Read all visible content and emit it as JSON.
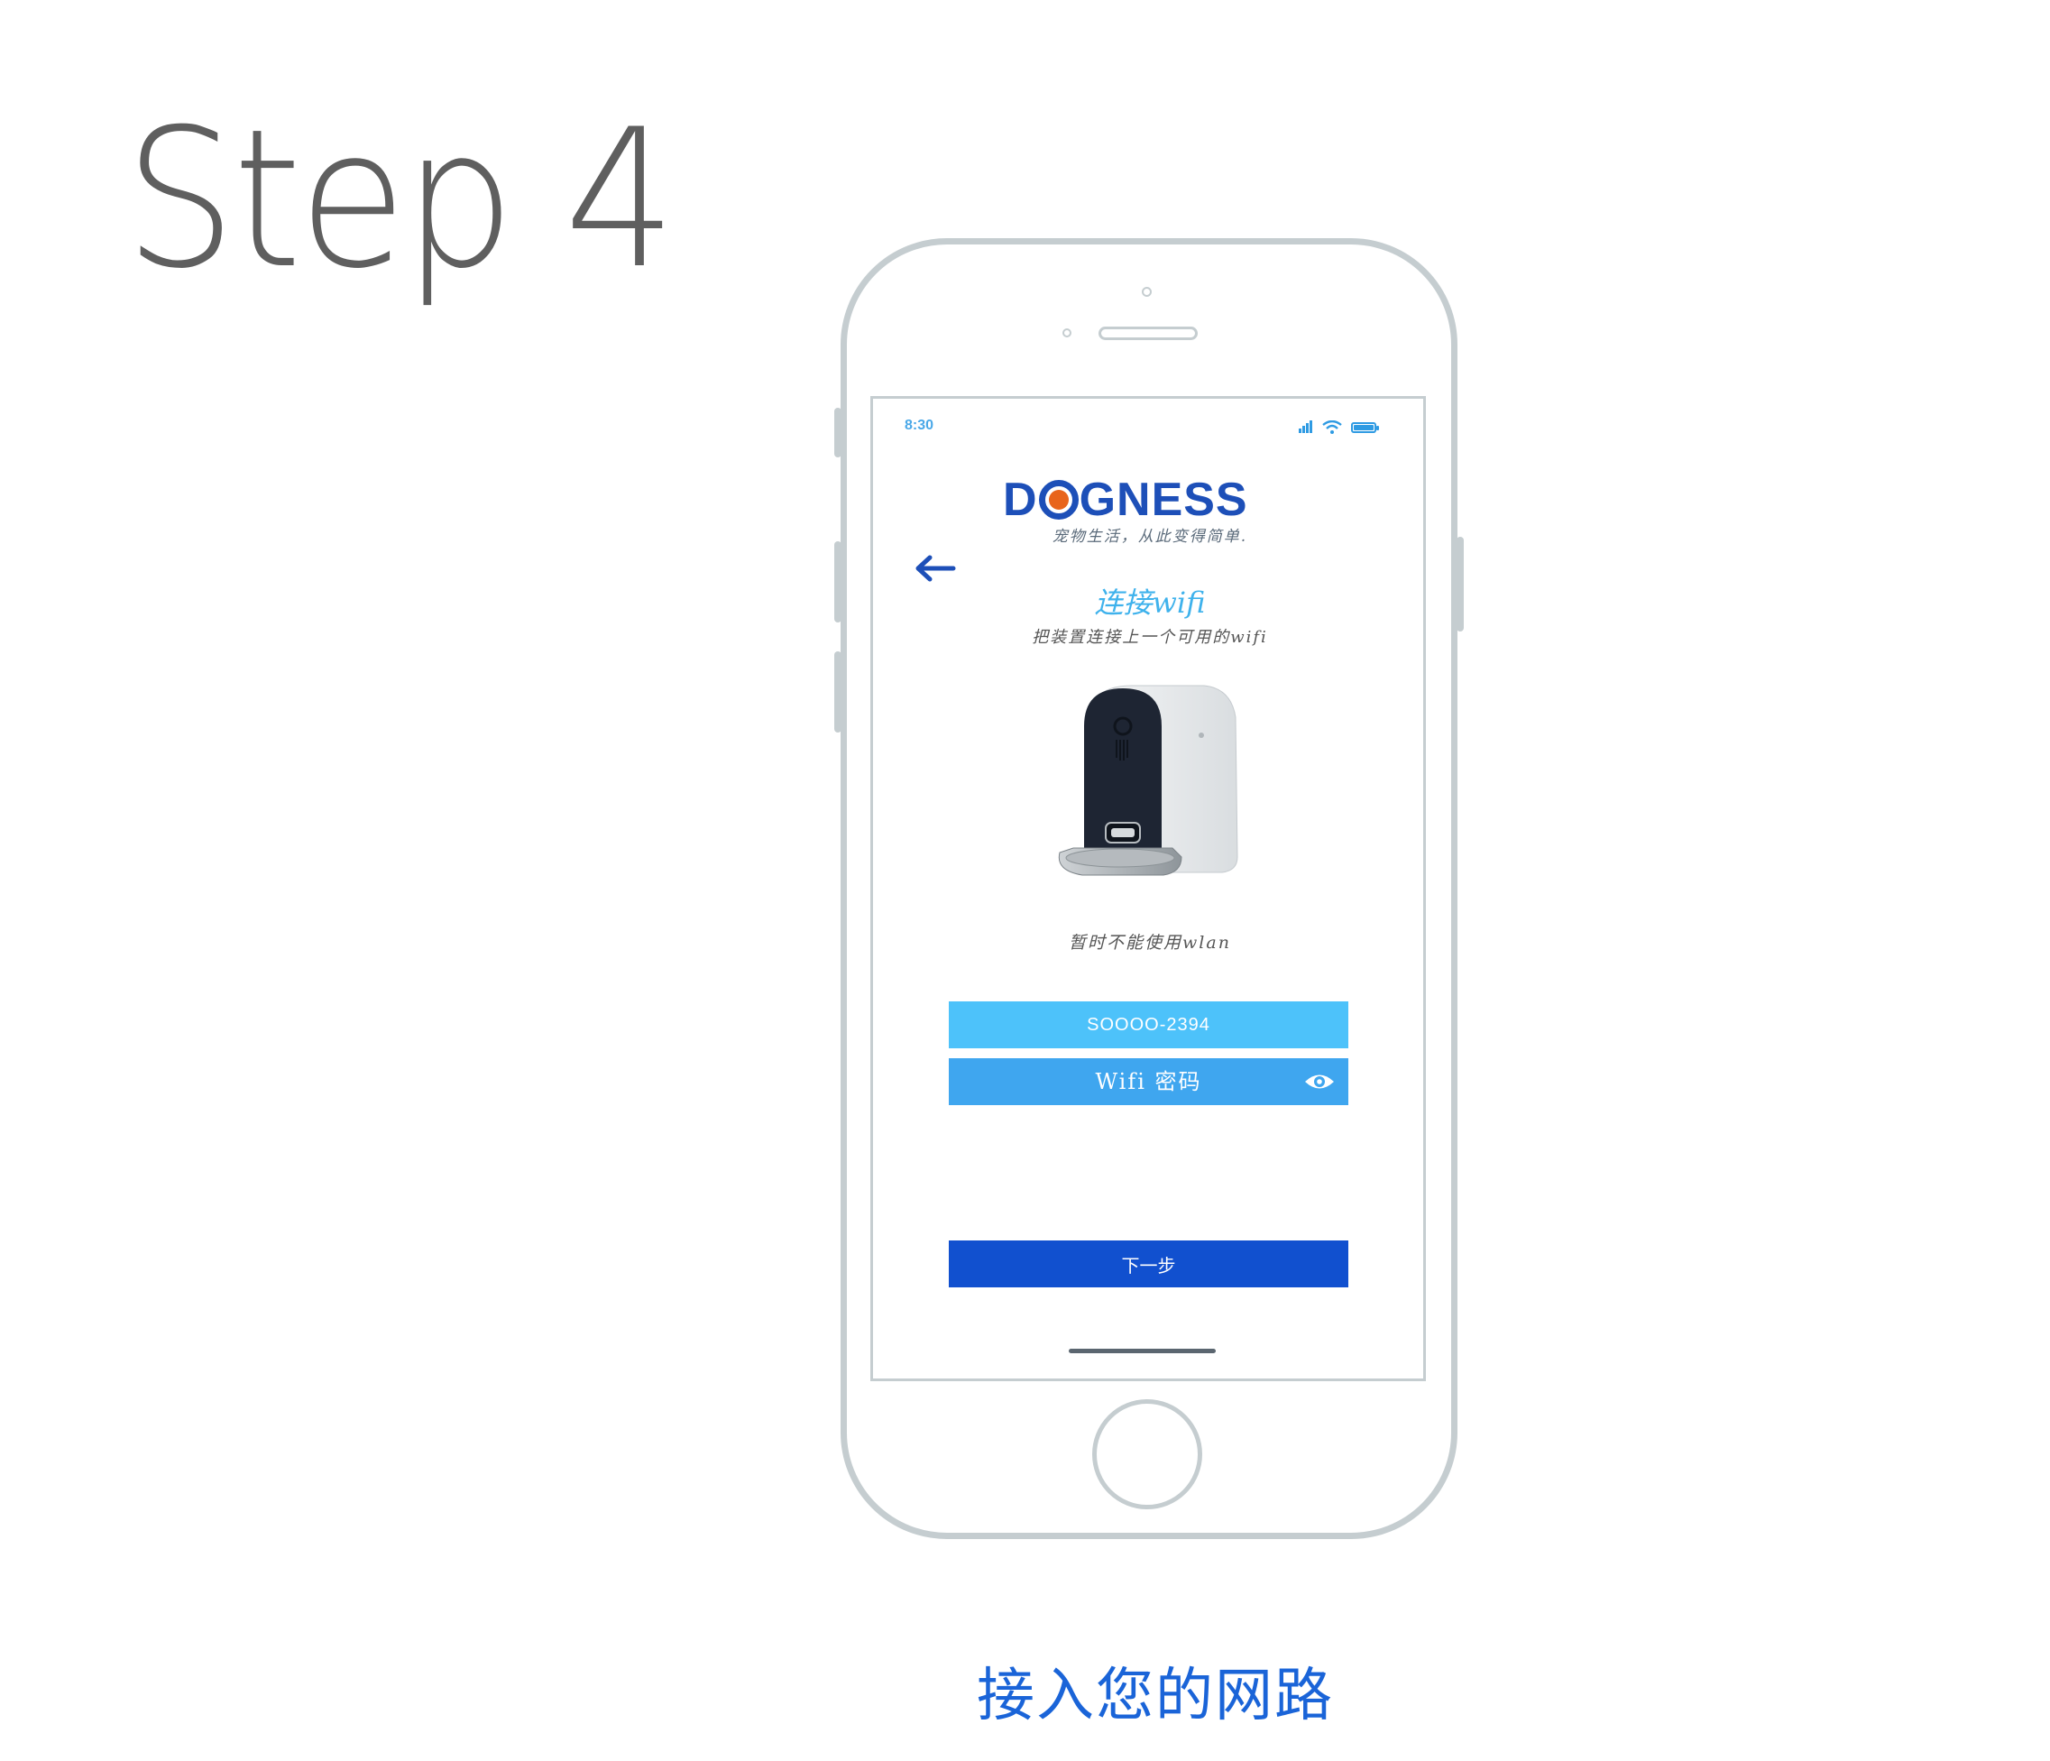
{
  "step_title": "Step 4",
  "status_bar": {
    "time": "8:30"
  },
  "logo": {
    "prefix": "D",
    "suffix": "GNESS",
    "slogan": "宠物生活，从此变得简单."
  },
  "connect": {
    "title": "连接wifi",
    "subtitle": "把装置连接上一个可用的wifi"
  },
  "wlan_note": "暂时不能使用wlan",
  "ssid_value": "SOOOO-2394",
  "password_placeholder": "Wifi 密码",
  "next_button": "下一步",
  "caption": "接入您的网路",
  "colors": {
    "accent_light": "#4dc2fa",
    "accent_mid": "#3fa6ef",
    "primary": "#1150cf",
    "logo_blue": "#1d4fb8",
    "logo_orange": "#e8641c",
    "caption": "#1a64d8"
  },
  "icons": [
    "back-arrow-icon",
    "signal-icon",
    "wifi-icon",
    "battery-icon",
    "eye-icon"
  ]
}
